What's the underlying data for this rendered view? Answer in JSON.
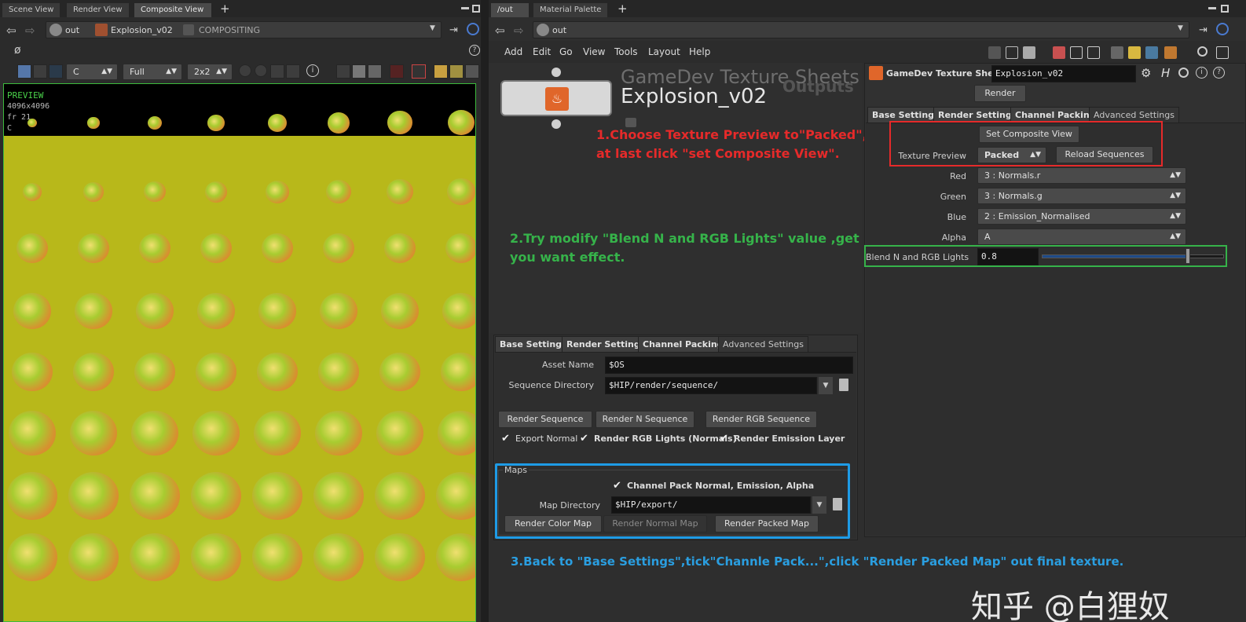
{
  "left_panel": {
    "tabs": [
      "Scene View",
      "Render View",
      "Composite View"
    ],
    "path": {
      "root": "out",
      "node": "Explosion_v02",
      "context": "COMPOSITING"
    },
    "toolbar": {
      "channel": "C",
      "resolution": "Full",
      "grid": "2x2",
      "empty_symbol": "ø"
    },
    "preview": {
      "title": "PREVIEW",
      "size": "4096x4096",
      "frame": "fr 21",
      "channel": "C"
    }
  },
  "right_panel": {
    "tabs": [
      "/out",
      "Material Palette"
    ],
    "path": {
      "root": "out"
    },
    "menu": [
      "Add",
      "Edit",
      "Go",
      "View",
      "Tools",
      "Layout",
      "Help"
    ]
  },
  "node": {
    "type_label": "GameDev Texture Sheets",
    "name": "Explosion_v02",
    "outputs_label": "Outputs"
  },
  "params_right": {
    "header_type": "GameDev Texture Sheets",
    "header_name": "Explosion_v02",
    "render_button": "Render",
    "tabs": [
      "Base Settings",
      "Render Settings",
      "Channel Packing",
      "Advanced Settings"
    ],
    "set_composite_view": "Set Composite View",
    "texture_preview_label": "Texture Preview",
    "texture_preview_value": "Packed",
    "reload_sequences": "Reload Sequences",
    "channels": [
      {
        "label": "Red",
        "value": "3 : Normals.r"
      },
      {
        "label": "Green",
        "value": "3 : Normals.g"
      },
      {
        "label": "Blue",
        "value": "2 : Emission_Normalised"
      },
      {
        "label": "Alpha",
        "value": "A"
      }
    ],
    "blend_label": "Blend N and RGB Lights",
    "blend_value": "0.8",
    "blend_fraction": 0.8
  },
  "params_left": {
    "tabs": [
      "Base Settings",
      "Render Settings",
      "Channel Packing",
      "Advanced Settings"
    ],
    "asset_name_label": "Asset Name",
    "asset_name_value": "$OS",
    "seq_dir_label": "Sequence Directory",
    "seq_dir_value": "$HIP/render/sequence/",
    "buttons": [
      "Render Sequence",
      "Render N Sequence",
      "Render RGB Sequence"
    ],
    "checks": [
      "Export Normal",
      "Render RGB Lights (Normals)",
      "Render Emission Layer"
    ],
    "maps_title": "Maps",
    "channel_pack_check": "Channel Pack Normal, Emission, Alpha",
    "map_dir_label": "Map Directory",
    "map_dir_value": "$HIP/export/",
    "map_buttons": [
      "Render Color Map",
      "Render Normal Map",
      "Render Packed Map"
    ]
  },
  "annotations": {
    "step1_line1": "1.Choose Texture Preview to\"Packed\",",
    "step1_line2": "at last click \"set Composite View\".",
    "step2_line1": "2.Try modify \"Blend N and RGB Lights\" value ,get",
    "step2_line2": "you want effect.",
    "step3": "3.Back to \"Base Settings\",tick\"Channle Pack...\",click \"Render Packed Map\" out final texture.",
    "watermark": "知乎 @白狸奴"
  },
  "colors": {
    "canvas_bg": "#b8b81a",
    "red_annot": "#e62a2a",
    "green_annot": "#36b34a",
    "blue_annot": "#2a9ee0",
    "node_icon": "#e0662a"
  }
}
